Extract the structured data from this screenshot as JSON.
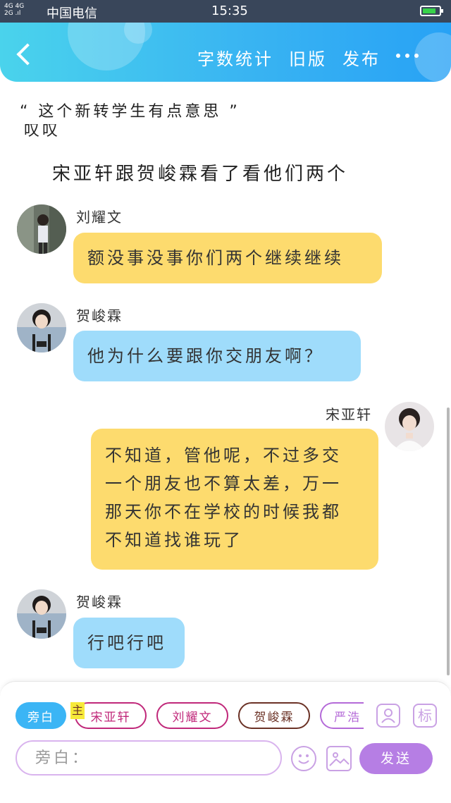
{
  "status_bar": {
    "network": "4G 4G\n2G .ıl",
    "carrier": "中国电信",
    "time": "15:35",
    "battery_level": 0.7
  },
  "header": {
    "actions": [
      "字数统计",
      "旧版",
      "发布"
    ],
    "more_icon": "more-dots-icon"
  },
  "story": {
    "quote": "“ 这个新转学生有点意思 ”",
    "cut_line": "叹叹",
    "line": "宋亚轩跟贺峻霖看了看他们两个"
  },
  "messages": [
    {
      "speaker": "刘耀文",
      "text": "额没事没事你们两个继续继续"
    },
    {
      "speaker": "贺峻霖",
      "text": "他为什么要跟你交朋友啊？"
    },
    {
      "speaker": "宋亚轩",
      "lines": [
        "不知道，管他呢，不过多交",
        "一个朋友也不算太差，万一",
        "那天你不在学校的时候我都",
        "不知道找谁玩了"
      ]
    },
    {
      "speaker": "贺峻霖",
      "text": "行吧行吧"
    }
  ],
  "composer": {
    "characters": [
      "旁白",
      "宋亚轩",
      "刘耀文",
      "贺峻霖",
      "严浩"
    ],
    "main_badge": "主",
    "profile_icon": "person-card-icon",
    "tag_button": "标",
    "input_placeholder": "旁白：",
    "send_label": "发送",
    "colors": {
      "active": "#3bb5f5",
      "send": "#b67ee4",
      "yellow_bubble": "#fddb6e",
      "blue_bubble": "#9fdcfb"
    }
  }
}
